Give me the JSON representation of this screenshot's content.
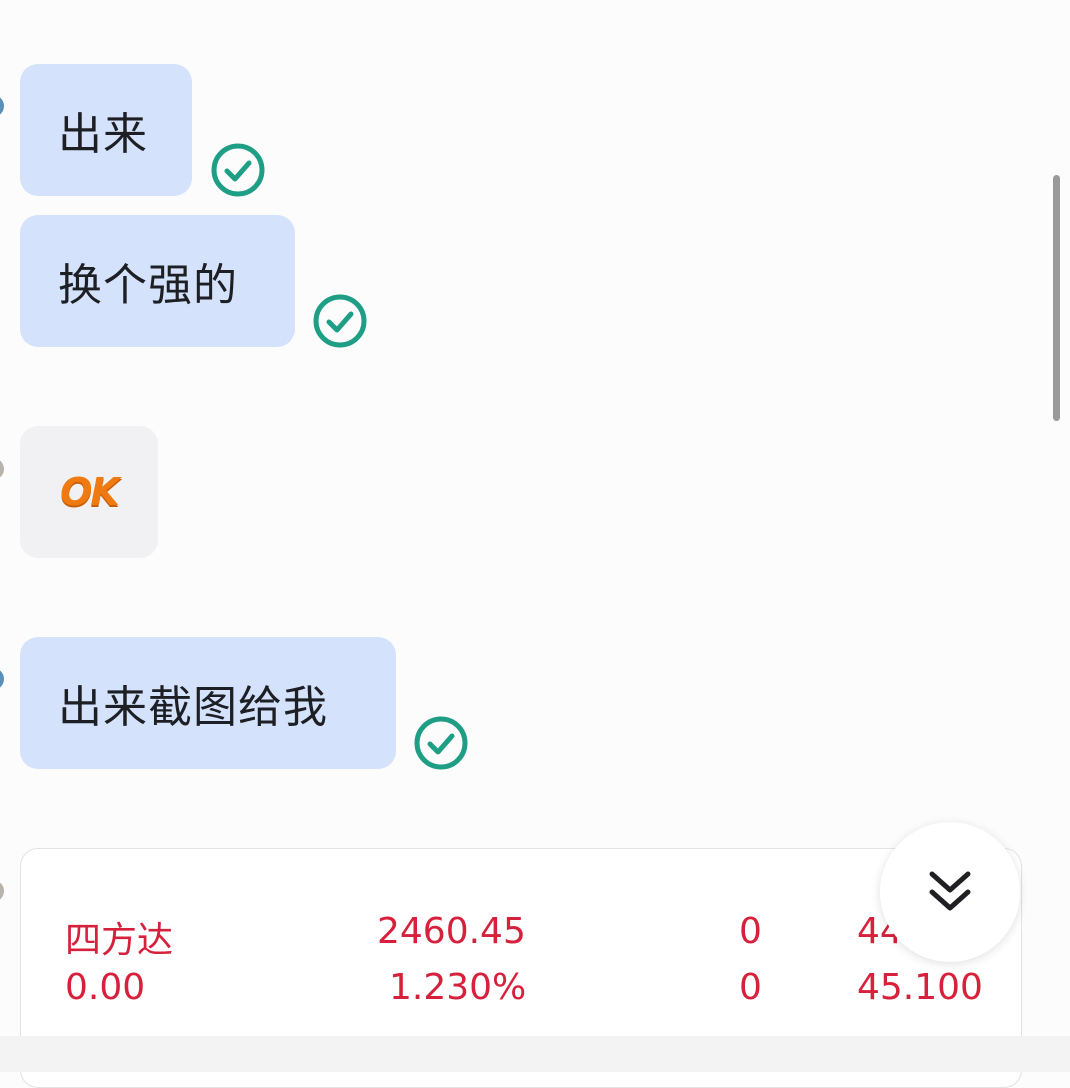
{
  "messages": [
    {
      "text": "出来",
      "status": "sent-check-icon"
    },
    {
      "text": "换个强的",
      "status": "sent-check-icon"
    },
    {
      "sticker": "OK",
      "status": ""
    },
    {
      "text": "出来截图给我",
      "status": "sent-check-icon"
    }
  ],
  "stock_card": {
    "row1": {
      "name": "四方达",
      "value": "2460.45",
      "zero": "0",
      "last": "44"
    },
    "row2": {
      "name": "0.00",
      "value": "1.230%",
      "zero": "0",
      "last": "45.100"
    }
  },
  "colors": {
    "bubble": "#d4e3fb",
    "check": "#1e9e84",
    "stock_red": "#d7203b",
    "sticker_orange": "#f07a12"
  },
  "icons": {
    "check": "check-circle-icon",
    "scroll_down": "double-chevron-down-icon"
  }
}
